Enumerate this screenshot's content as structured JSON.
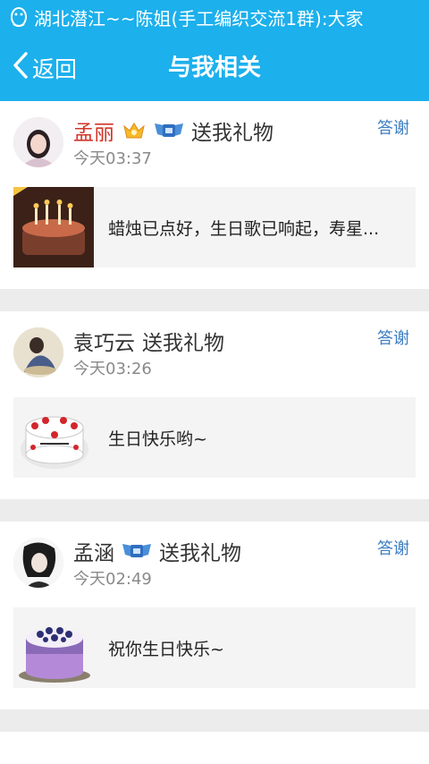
{
  "colors": {
    "accent": "#1cb0ec",
    "vip_name": "#d2352a",
    "thank_link": "#3b7cc2"
  },
  "notification": {
    "icon": "qq-penguin-icon",
    "text": "湖北潜江~~陈姐(手工编织交流1群):大家"
  },
  "nav": {
    "back_icon": "chevron-left-icon",
    "back_label": "返回",
    "title": "与我相关"
  },
  "feed": [
    {
      "user": "孟丽",
      "badges": [
        "crown-badge-icon",
        "vip-wings-badge-icon"
      ],
      "action": "送我礼物",
      "time": "今天03:37",
      "thank_label": "答谢",
      "gift_message": "蜡烛已点好，生日歌已响起，寿星..."
    },
    {
      "user": "袁巧云",
      "badges": [],
      "action": "送我礼物",
      "time": "今天03:26",
      "thank_label": "答谢",
      "gift_message": "生日快乐哟~"
    },
    {
      "user": "孟涵",
      "badges": [
        "vip-wings-badge-icon"
      ],
      "action": "送我礼物",
      "time": "今天02:49",
      "thank_label": "答谢",
      "gift_message": "祝你生日快乐~"
    }
  ]
}
